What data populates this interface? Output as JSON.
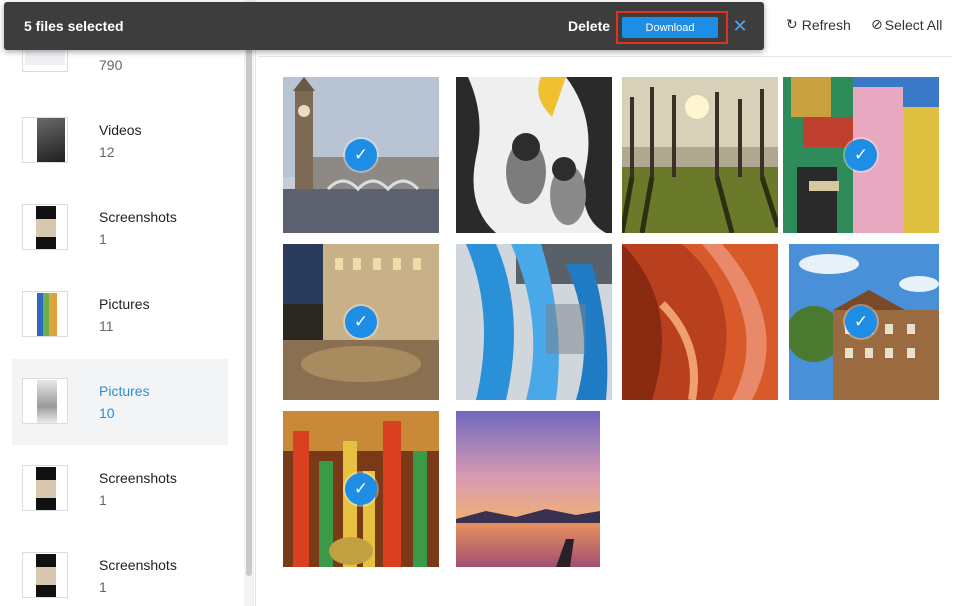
{
  "selection_bar": {
    "count_label": "5 files selected",
    "delete_label": "Delete",
    "download_label": "Download",
    "close_glyph": "✕"
  },
  "toolbar": {
    "refresh_label": "Refresh",
    "refresh_icon": "↻",
    "select_all_label": "Select All",
    "select_all_icon": "⊘"
  },
  "sidebar": {
    "albums": [
      {
        "name": "",
        "count": "790"
      },
      {
        "name": "Videos",
        "count": "12"
      },
      {
        "name": "Screenshots",
        "count": "1"
      },
      {
        "name": "Pictures",
        "count": "11"
      },
      {
        "name": "Pictures",
        "count": "10",
        "active": true
      },
      {
        "name": "Screenshots",
        "count": "1"
      },
      {
        "name": "Screenshots",
        "count": "1"
      }
    ]
  },
  "photos": [
    {
      "subject": "big-ben",
      "selected": true
    },
    {
      "subject": "penguins",
      "selected": false
    },
    {
      "subject": "trees-sunset",
      "selected": false
    },
    {
      "subject": "colorful-building",
      "selected": true
    },
    {
      "subject": "night-plaza",
      "selected": true
    },
    {
      "subject": "blue-sculpture",
      "selected": false
    },
    {
      "subject": "canyon",
      "selected": false
    },
    {
      "subject": "brick-houses",
      "selected": true
    },
    {
      "subject": "hookahs",
      "selected": true
    },
    {
      "subject": "lake-sunset",
      "selected": false
    }
  ],
  "colors": {
    "accent": "#1e8de6",
    "highlight_border": "#e0321f",
    "bar": "#3d3d3d"
  },
  "check_glyph": "✓"
}
